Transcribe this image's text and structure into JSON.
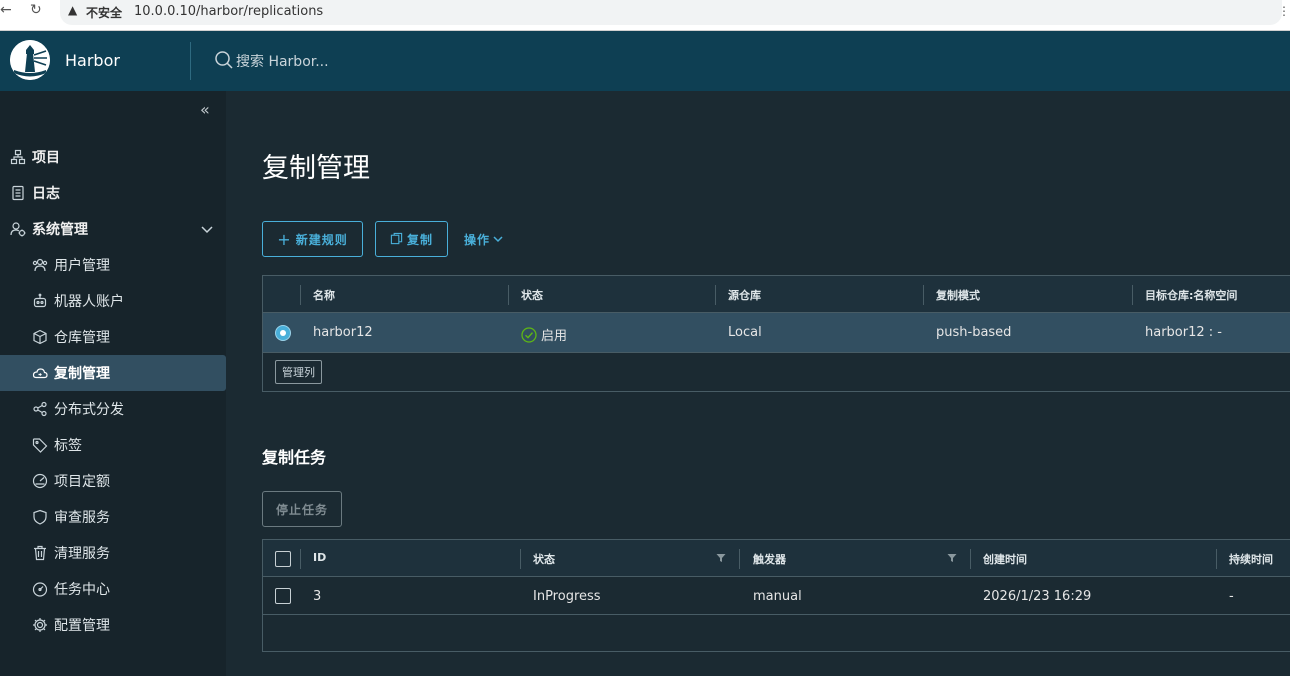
{
  "browser": {
    "back": "←",
    "reload": "↻",
    "warning": "▲",
    "insecure_label": "不安全",
    "url": "10.0.0.10/harbor/replications"
  },
  "header": {
    "app_title": "Harbor",
    "search_placeholder": "搜索 Harbor..."
  },
  "sidebar": {
    "collapse_glyph": "«",
    "items": [
      {
        "label": "项目",
        "icon": "projects-icon",
        "level": "top"
      },
      {
        "label": "日志",
        "icon": "logs-icon",
        "level": "top"
      },
      {
        "label": "系统管理",
        "icon": "admin-icon",
        "level": "top",
        "expanded": true
      },
      {
        "label": "用户管理",
        "icon": "users-icon",
        "level": "sub"
      },
      {
        "label": "机器人账户",
        "icon": "robot-icon",
        "level": "sub"
      },
      {
        "label": "仓库管理",
        "icon": "registry-icon",
        "level": "sub"
      },
      {
        "label": "复制管理",
        "icon": "replication-icon",
        "level": "sub",
        "active": true
      },
      {
        "label": "分布式分发",
        "icon": "share-icon",
        "level": "sub"
      },
      {
        "label": "标签",
        "icon": "tag-icon",
        "level": "sub"
      },
      {
        "label": "项目定额",
        "icon": "quota-icon",
        "level": "sub"
      },
      {
        "label": "审查服务",
        "icon": "shield-icon",
        "level": "sub"
      },
      {
        "label": "清理服务",
        "icon": "trash-icon",
        "level": "sub"
      },
      {
        "label": "任务中心",
        "icon": "dashboard-icon",
        "level": "sub"
      },
      {
        "label": "配置管理",
        "icon": "gear-icon",
        "level": "sub"
      }
    ]
  },
  "main": {
    "page_title": "复制管理",
    "toolbar": {
      "new_rule_label": "新建规则",
      "copy_label": "复制",
      "ops_label": "操作"
    },
    "rules_table": {
      "columns": [
        "名称",
        "状态",
        "源仓库",
        "复制模式",
        "目标仓库:名称空间"
      ],
      "rows": [
        {
          "name": "harbor12",
          "status": "启用",
          "source": "Local",
          "mode": "push-based",
          "target": "harbor12 : -",
          "selected": true
        }
      ],
      "manage_columns_label": "管理列"
    },
    "tasks_section_title": "复制任务",
    "stop_task_label": "停止任务",
    "tasks_table": {
      "columns": [
        "ID",
        "状态",
        "触发器",
        "创建时间",
        "持续时间"
      ],
      "rows": [
        {
          "id": "3",
          "status": "InProgress",
          "trigger": "manual",
          "created": "2026/1/23 16:29",
          "duration": "-"
        }
      ]
    }
  },
  "colors": {
    "header_bg": "#0e3f53",
    "sidebar_bg": "#17242b",
    "main_bg": "#1b2a32",
    "accent": "#49afd9",
    "active_item_bg": "#324f61",
    "success": "#5eb715"
  }
}
